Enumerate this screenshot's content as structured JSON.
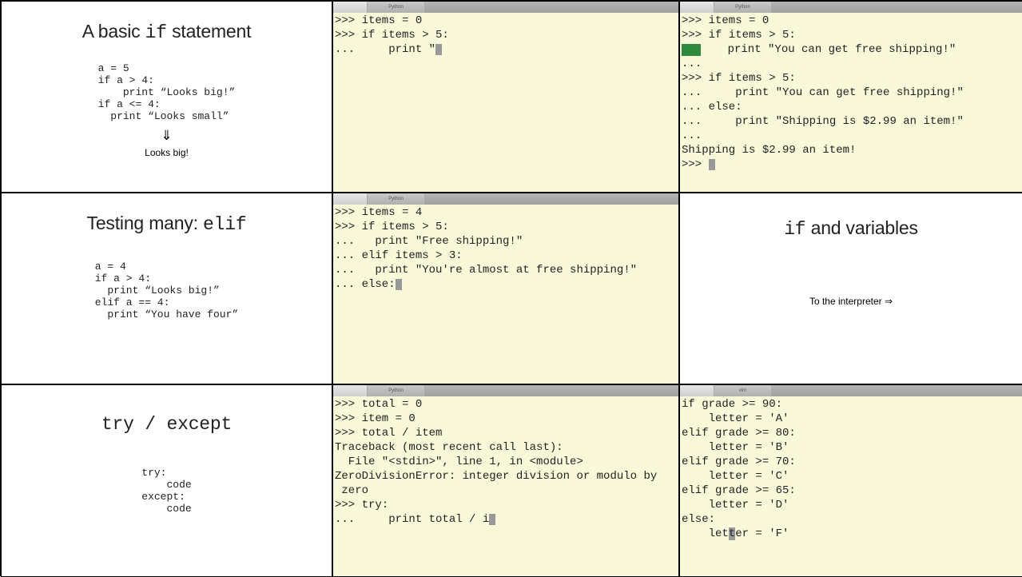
{
  "grid": {
    "r1c1": {
      "title_pre": "A basic ",
      "title_mono": "if",
      "title_post": " statement",
      "code": "a = 5\nif a > 4:\n    print “Looks big!”\nif a <= 4:\n  print “Looks small”",
      "arrow": "⇓",
      "output": "Looks big!"
    },
    "r1c2": {
      "tab": "Python",
      "body_pre": ">>> items = 0\n>>> if items > 5:\n...     print \""
    },
    "r1c3": {
      "tab": "Python",
      "line1": ">>> items = 0",
      "line2": ">>> if items > 5:",
      "line3_after": "    print \"You can get free shipping!\"",
      "rest": "... \n>>> if items > 5:\n...     print \"You can get free shipping!\"\n... else:\n...     print \"Shipping is $2.99 an item!\"\n... \nShipping is $2.99 an item!\n>>> "
    },
    "r2c1": {
      "title_pre": "Testing many: ",
      "title_mono": "elif",
      "code": "a = 4\nif a > 4:\n  print “Looks big!”\nelif a == 4:\n  print “You have four”"
    },
    "r2c2": {
      "tab": "Python",
      "body_pre": ">>> items = 4\n>>> if items > 5:\n...   print \"Free shipping!\"\n... elif items > 3:\n...   print \"You're almost at free shipping!\"\n... else:"
    },
    "r2c3": {
      "title_mono": "if",
      "title_post": " and variables",
      "sub": "To the interpreter ⇒"
    },
    "r3c1": {
      "title_mono": "try / except",
      "code": "try:\n    code\nexcept:\n    code"
    },
    "r3c2": {
      "tab": "Python",
      "body_pre": ">>> total = 0\n>>> item = 0\n>>> total / item\nTraceback (most recent call last):\n  File \"<stdin>\", line 1, in <module>\nZeroDivisionError: integer division or modulo by\n zero\n>>> try:\n...     print total / i"
    },
    "r3c3": {
      "tab": "vim",
      "body_pre": "if grade >= 90:\n    letter = 'A'\nelif grade >= 80:\n    letter = 'B'\nelif grade >= 70:\n    letter = 'C'\nelif grade >= 65:\n    letter = 'D'\nelse:\n    let",
      "body_hi": "t",
      "body_post": "er = 'F'"
    }
  }
}
